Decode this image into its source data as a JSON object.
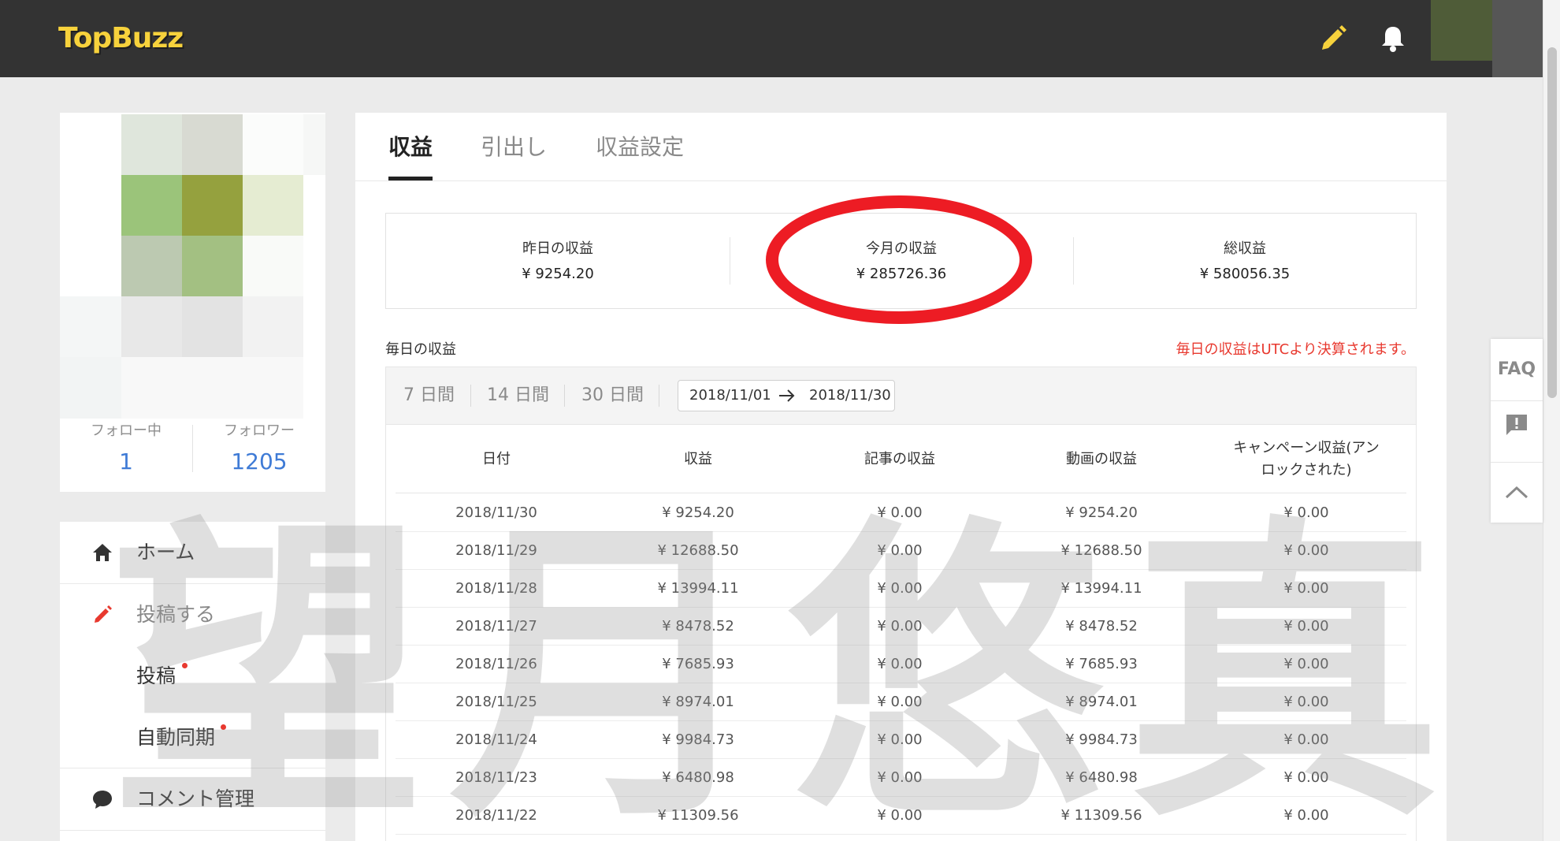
{
  "app": {
    "logo": "TopBuzz"
  },
  "profile": {
    "following_label": "フォロー中",
    "following_count": "1",
    "followers_label": "フォロワー",
    "followers_count": "1205",
    "mosaic_colors": [
      "#ffffff",
      "#dfe6dc",
      "#d8dad2",
      "#fbfcfb",
      "#f6f7f6",
      "#ffffff",
      "#9bc47a",
      "#95a13e",
      "#e5ecd2",
      "#ffffff",
      "#ffffff",
      "#bcc9b1",
      "#a3c082",
      "#f9faf8",
      "#ffffff",
      "#f4f6f6",
      "#e8e8e8",
      "#e3e3e3",
      "#f2f2f2",
      "#ffffff",
      "#f2f4f4",
      "#f8f8f8",
      "#f8f8f8",
      "#f8f8f8",
      "#ffffff"
    ]
  },
  "menu": {
    "home": "ホーム",
    "post_section": "投稿する",
    "post": "投稿",
    "auto_sync": "自動同期",
    "comments": "コメント管理"
  },
  "tabs": {
    "earnings": "収益",
    "withdraw": "引出し",
    "settings": "収益設定"
  },
  "summary": {
    "yesterday_label": "昨日の収益",
    "yesterday_value": "¥ 9254.20",
    "month_label": "今月の収益",
    "month_value": "¥ 285726.36",
    "total_label": "総収益",
    "total_value": "¥ 580056.35"
  },
  "daily": {
    "title": "毎日の収益",
    "utc_note": "毎日の収益はUTCより決算されます。",
    "filters": [
      "7 日間",
      "14 日間",
      "30 日間"
    ],
    "range_start": "2018/11/01",
    "range_end": "2018/11/30"
  },
  "table": {
    "headers": [
      "日付",
      "収益",
      "記事の収益",
      "動画の収益",
      "キャンペーン収益(アンロックされた)"
    ],
    "rows": [
      [
        "2018/11/30",
        "¥ 9254.20",
        "¥ 0.00",
        "¥ 9254.20",
        "¥ 0.00"
      ],
      [
        "2018/11/29",
        "¥ 12688.50",
        "¥ 0.00",
        "¥ 12688.50",
        "¥ 0.00"
      ],
      [
        "2018/11/28",
        "¥ 13994.11",
        "¥ 0.00",
        "¥ 13994.11",
        "¥ 0.00"
      ],
      [
        "2018/11/27",
        "¥ 8478.52",
        "¥ 0.00",
        "¥ 8478.52",
        "¥ 0.00"
      ],
      [
        "2018/11/26",
        "¥ 7685.93",
        "¥ 0.00",
        "¥ 7685.93",
        "¥ 0.00"
      ],
      [
        "2018/11/25",
        "¥ 8974.01",
        "¥ 0.00",
        "¥ 8974.01",
        "¥ 0.00"
      ],
      [
        "2018/11/24",
        "¥ 9984.73",
        "¥ 0.00",
        "¥ 9984.73",
        "¥ 0.00"
      ],
      [
        "2018/11/23",
        "¥ 6480.98",
        "¥ 0.00",
        "¥ 6480.98",
        "¥ 0.00"
      ],
      [
        "2018/11/22",
        "¥ 11309.56",
        "¥ 0.00",
        "¥ 11309.56",
        "¥ 0.00"
      ]
    ]
  },
  "widget": {
    "faq": "FAQ"
  },
  "watermark": "望月悠真",
  "colors": {
    "topbar": "#333333",
    "logo": "#f7d23c",
    "accent_blue": "#3f7bd6",
    "alert_red": "#e8392f",
    "annotation_red": "#ed1c24"
  },
  "icons": [
    "pencil-icon",
    "bell-icon",
    "home-icon",
    "edit-icon",
    "comment-icon",
    "feedback-icon",
    "chevron-up-icon",
    "arrow-right-icon"
  ]
}
